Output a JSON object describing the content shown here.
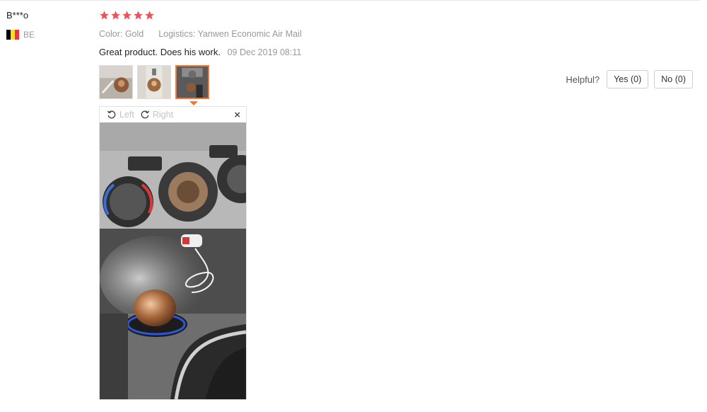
{
  "user": {
    "name": "B***o",
    "country": "BE",
    "flag_colors": [
      "#000000",
      "#FDDA24",
      "#EF3340"
    ]
  },
  "rating": {
    "stars": 5,
    "max": 5,
    "color": "#e8555a"
  },
  "meta": {
    "color_label": "Color:",
    "color_value": "Gold",
    "logistics_label": "Logistics:",
    "logistics_value": "Yanwen Economic Air Mail"
  },
  "review": {
    "text": "Great product. Does his work.",
    "date": "09 Dec 2019 08:11"
  },
  "thumbnails": {
    "count": 3,
    "active_index": 2,
    "active_color": "#f27935"
  },
  "viewer": {
    "rotate_left": "Left",
    "rotate_right": "Right",
    "close": "×"
  },
  "helpful": {
    "label": "Helpful?",
    "yes": "Yes (0)",
    "no": "No (0)"
  }
}
